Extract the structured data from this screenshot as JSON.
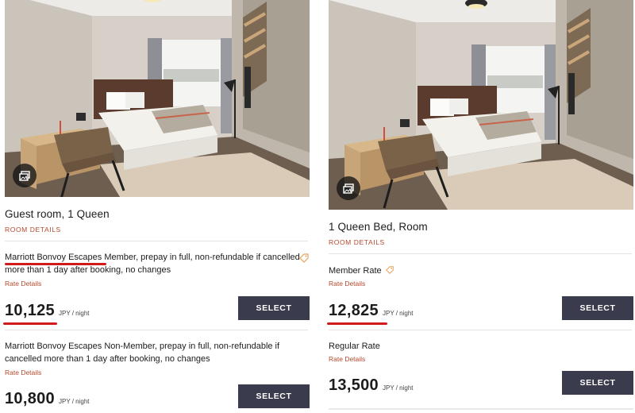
{
  "colors": {
    "accent_link": "#b5472c",
    "button_bg": "#3b3b4e",
    "highlight_red": "#d11a1a",
    "tag_orange": "#e7a35b"
  },
  "left_card": {
    "room_title": "Guest room, 1 Queen",
    "room_details_link": "ROOM DETAILS",
    "gallery_icon": "gallery-icon",
    "rates": [
      {
        "description": "Marriott Bonvoy Escapes Member, prepay in full, non-refundable if cancelled more than 1 day after booking, no changes",
        "description_highlight": "Marriott Bonvoy Escapes",
        "description_rest": " Member, prepay in full, non-refundable if cancelled more than 1 day after booking, no changes",
        "details_link": "Rate Details",
        "price": "10,125",
        "unit": "JPY / night",
        "button": "SELECT",
        "icon": "tag-icon"
      },
      {
        "description": "Marriott Bonvoy Escapes Non-Member, prepay in full, non-refundable if cancelled more than 1 day after booking, no changes",
        "details_link": "Rate Details",
        "price": "10,800",
        "unit": "JPY / night",
        "button": "SELECT"
      }
    ]
  },
  "right_card": {
    "room_title": "1 Queen Bed, Room",
    "room_details_link": "ROOM DETAILS",
    "gallery_icon": "gallery-icon",
    "rates": [
      {
        "description": "Member Rate",
        "details_link": "Rate Details",
        "price": "12,825",
        "unit": "JPY / night",
        "button": "SELECT",
        "icon": "tag-icon"
      },
      {
        "description": "Regular Rate",
        "details_link": "Rate Details",
        "price": "13,500",
        "unit": "JPY / night",
        "button": "SELECT"
      }
    ]
  }
}
